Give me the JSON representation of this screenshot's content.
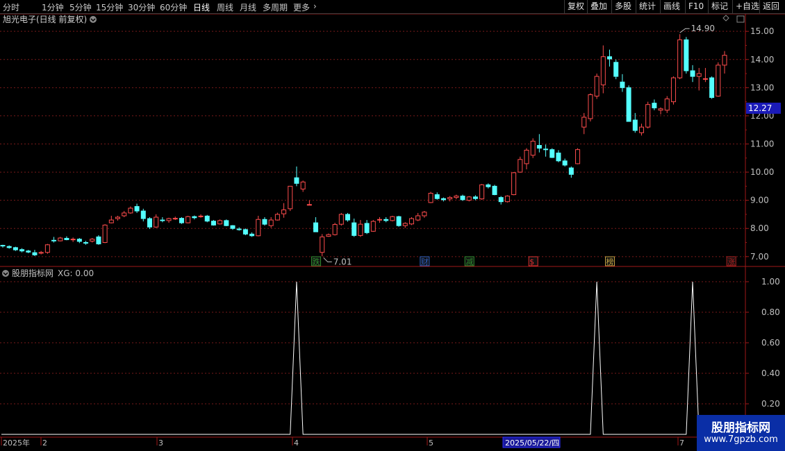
{
  "toolbar": {
    "periods": [
      "分时",
      "1分钟",
      "5分钟",
      "15分钟",
      "30分钟",
      "60分钟",
      "日线",
      "周线",
      "月线",
      "多周期",
      "更多"
    ],
    "active": "日线",
    "right": [
      "复权",
      "叠加",
      "多股",
      "统计",
      "画线",
      "F10",
      "标记",
      "+自选",
      "返回"
    ]
  },
  "chart_title": "旭光电子(日线 前复权)",
  "price_axis": {
    "ticks": [
      "15.00",
      "14.00",
      "13.00",
      "12.00",
      "11.00",
      "10.00",
      "9.00",
      "8.00",
      "7.00"
    ],
    "current": "12.27"
  },
  "annotations": {
    "high": "14.90",
    "low": "7.01"
  },
  "event_markers": [
    {
      "label": "跌",
      "color": "#2f8f2f"
    },
    {
      "label": "财",
      "color": "#2f5fbf"
    },
    {
      "label": "减",
      "color": "#2f8f2f"
    },
    {
      "label": "$",
      "color": "#e03030"
    },
    {
      "label": "榜",
      "color": "#c0a040"
    },
    {
      "label": "涨",
      "color": "#b02020"
    }
  ],
  "indicator": {
    "title": "股朋指标网",
    "readout": "XG: 0.00",
    "ticks": [
      "1.00",
      "0.80",
      "0.60",
      "0.40",
      "0.20"
    ]
  },
  "date_axis": {
    "labels": [
      "2025年",
      "2",
      "3",
      "4",
      "5",
      "7"
    ],
    "cursor_date": "2025/05/22/四"
  },
  "watermark": {
    "title": "股朋指标网",
    "url": "www.7gpzb.com"
  },
  "colors": {
    "up": "#ff4d4d",
    "down": "#54ffff",
    "grid": "#7a1a1a",
    "axis": "#a01818",
    "text": "#c0c0c0",
    "current_price_bg": "#1a1ab8"
  },
  "chart_data": {
    "type": "candlestick",
    "title": "旭光电子(日线 前复权)",
    "ylim": [
      6.7,
      15.3
    ],
    "candles": [
      [
        7.4,
        7.42,
        7.32,
        7.38
      ],
      [
        7.36,
        7.4,
        7.28,
        7.32
      ],
      [
        7.32,
        7.35,
        7.2,
        7.24
      ],
      [
        7.25,
        7.3,
        7.15,
        7.2
      ],
      [
        7.2,
        7.24,
        7.12,
        7.16
      ],
      [
        7.14,
        7.24,
        7.02,
        7.06
      ],
      [
        7.12,
        7.2,
        7.08,
        7.15
      ],
      [
        7.15,
        7.45,
        7.1,
        7.42
      ],
      [
        7.58,
        7.7,
        7.5,
        7.56
      ],
      [
        7.56,
        7.7,
        7.54,
        7.66
      ],
      [
        7.65,
        7.72,
        7.58,
        7.6
      ],
      [
        7.6,
        7.68,
        7.52,
        7.62
      ],
      [
        7.62,
        7.66,
        7.48,
        7.54
      ],
      [
        7.5,
        7.56,
        7.42,
        7.48
      ],
      [
        7.55,
        7.66,
        7.5,
        7.62
      ],
      [
        7.7,
        7.76,
        7.42,
        7.45
      ],
      [
        7.5,
        8.15,
        7.48,
        8.12
      ],
      [
        8.2,
        8.45,
        8.18,
        8.3
      ],
      [
        8.35,
        8.45,
        8.28,
        8.4
      ],
      [
        8.45,
        8.62,
        8.4,
        8.55
      ],
      [
        8.55,
        8.78,
        8.52,
        8.72
      ],
      [
        8.78,
        8.88,
        8.55,
        8.62
      ],
      [
        8.62,
        8.7,
        8.25,
        8.35
      ],
      [
        8.35,
        8.4,
        7.98,
        8.05
      ],
      [
        8.05,
        8.5,
        8.02,
        8.4
      ],
      [
        8.3,
        8.4,
        8.22,
        8.28
      ],
      [
        8.28,
        8.38,
        8.2,
        8.35
      ],
      [
        8.35,
        8.42,
        8.3,
        8.36
      ],
      [
        8.36,
        8.4,
        8.16,
        8.2
      ],
      [
        8.2,
        8.45,
        8.18,
        8.42
      ],
      [
        8.42,
        8.46,
        8.32,
        8.38
      ],
      [
        8.42,
        8.5,
        8.38,
        8.44
      ],
      [
        8.44,
        8.48,
        8.22,
        8.26
      ],
      [
        8.26,
        8.3,
        8.1,
        8.12
      ],
      [
        8.16,
        8.32,
        8.14,
        8.28
      ],
      [
        8.28,
        8.32,
        8.08,
        8.1
      ],
      [
        8.1,
        8.12,
        7.95,
        8.0
      ],
      [
        7.98,
        8.04,
        7.92,
        7.96
      ],
      [
        7.96,
        8.0,
        7.76,
        7.8
      ],
      [
        7.8,
        7.86,
        7.7,
        7.74
      ],
      [
        7.74,
        8.45,
        7.72,
        8.32
      ],
      [
        8.32,
        8.4,
        8.1,
        8.15
      ],
      [
        8.1,
        8.4,
        8.02,
        8.3
      ],
      [
        8.3,
        8.56,
        8.28,
        8.5
      ],
      [
        8.52,
        8.9,
        8.38,
        8.66
      ],
      [
        8.7,
        9.5,
        8.62,
        9.5
      ],
      [
        9.8,
        10.2,
        9.5,
        9.6
      ],
      [
        9.4,
        9.7,
        9.3,
        9.65
      ],
      [
        8.85,
        9.0,
        8.82,
        8.85
      ],
      [
        8.2,
        8.4,
        7.88,
        7.88
      ],
      [
        7.15,
        7.8,
        7.01,
        7.7
      ],
      [
        7.72,
        7.82,
        7.7,
        7.78
      ],
      [
        7.78,
        8.2,
        7.75,
        8.14
      ],
      [
        8.15,
        8.55,
        8.1,
        8.5
      ],
      [
        8.5,
        8.55,
        8.24,
        8.3
      ],
      [
        8.2,
        8.35,
        7.7,
        7.75
      ],
      [
        7.75,
        8.3,
        7.7,
        8.15
      ],
      [
        8.18,
        8.3,
        7.8,
        7.85
      ],
      [
        7.9,
        8.3,
        7.88,
        8.25
      ],
      [
        8.3,
        8.4,
        8.2,
        8.32
      ],
      [
        8.32,
        8.4,
        8.22,
        8.28
      ],
      [
        8.28,
        8.45,
        8.25,
        8.42
      ],
      [
        8.42,
        8.45,
        8.06,
        8.1
      ],
      [
        8.1,
        8.22,
        8.02,
        8.18
      ],
      [
        8.16,
        8.4,
        8.12,
        8.35
      ],
      [
        8.3,
        8.55,
        8.26,
        8.45
      ],
      [
        8.45,
        8.62,
        8.38,
        8.58
      ],
      [
        8.92,
        9.3,
        8.9,
        9.25
      ],
      [
        9.2,
        9.28,
        9.02,
        9.06
      ],
      [
        9.06,
        9.1,
        8.96,
        9.02
      ],
      [
        9.05,
        9.15,
        8.96,
        9.1
      ],
      [
        9.1,
        9.2,
        9.04,
        9.15
      ],
      [
        9.15,
        9.2,
        8.98,
        9.02
      ],
      [
        9.0,
        9.15,
        8.96,
        9.12
      ],
      [
        9.12,
        9.18,
        9.0,
        9.06
      ],
      [
        9.05,
        9.58,
        9.02,
        9.55
      ],
      [
        9.55,
        9.6,
        9.42,
        9.48
      ],
      [
        9.5,
        9.55,
        9.18,
        9.2
      ],
      [
        9.1,
        9.15,
        8.85,
        8.95
      ],
      [
        8.95,
        9.18,
        8.92,
        9.15
      ],
      [
        9.2,
        10.0,
        9.18,
        9.98
      ],
      [
        10.0,
        10.55,
        9.98,
        10.45
      ],
      [
        10.3,
        10.85,
        10.1,
        10.78
      ],
      [
        10.6,
        11.2,
        10.5,
        11.1
      ],
      [
        10.95,
        11.35,
        10.7,
        10.85
      ],
      [
        10.82,
        10.98,
        10.55,
        10.8
      ],
      [
        10.8,
        10.85,
        10.5,
        10.52
      ],
      [
        10.68,
        10.78,
        10.35,
        10.4
      ],
      [
        10.4,
        10.48,
        10.2,
        10.25
      ],
      [
        10.15,
        10.2,
        9.8,
        9.92
      ],
      [
        10.3,
        10.85,
        10.28,
        10.8
      ],
      [
        11.6,
        12.1,
        11.35,
        11.95
      ],
      [
        11.9,
        12.8,
        11.8,
        12.75
      ],
      [
        12.7,
        13.5,
        12.6,
        13.4
      ],
      [
        13.1,
        14.5,
        12.8,
        14.1
      ],
      [
        14.1,
        14.35,
        13.75,
        14.02
      ],
      [
        13.9,
        14.0,
        13.3,
        13.4
      ],
      [
        13.2,
        13.48,
        12.85,
        13.0
      ],
      [
        13.0,
        13.08,
        11.9,
        11.8
      ],
      [
        11.85,
        12.1,
        11.4,
        11.48
      ],
      [
        11.4,
        11.72,
        11.3,
        11.6
      ],
      [
        11.6,
        12.5,
        11.55,
        12.4
      ],
      [
        12.45,
        12.58,
        12.2,
        12.28
      ],
      [
        12.2,
        12.3,
        12.05,
        12.25
      ],
      [
        12.2,
        12.7,
        12.1,
        12.6
      ],
      [
        12.5,
        13.4,
        12.4,
        13.35
      ],
      [
        13.35,
        14.9,
        13.3,
        14.7
      ],
      [
        14.7,
        14.8,
        13.5,
        13.6
      ],
      [
        13.6,
        13.8,
        13.2,
        13.4
      ],
      [
        13.4,
        13.7,
        12.9,
        13.5
      ],
      [
        13.3,
        13.7,
        13.2,
        13.32
      ],
      [
        13.35,
        13.4,
        12.6,
        12.65
      ],
      [
        12.7,
        13.9,
        12.68,
        13.8
      ],
      [
        13.8,
        14.3,
        13.5,
        14.15
      ]
    ],
    "indicator_series": {
      "name": "XG",
      "peak_days": [
        46,
        93,
        108
      ],
      "range": [
        0,
        1
      ]
    }
  }
}
